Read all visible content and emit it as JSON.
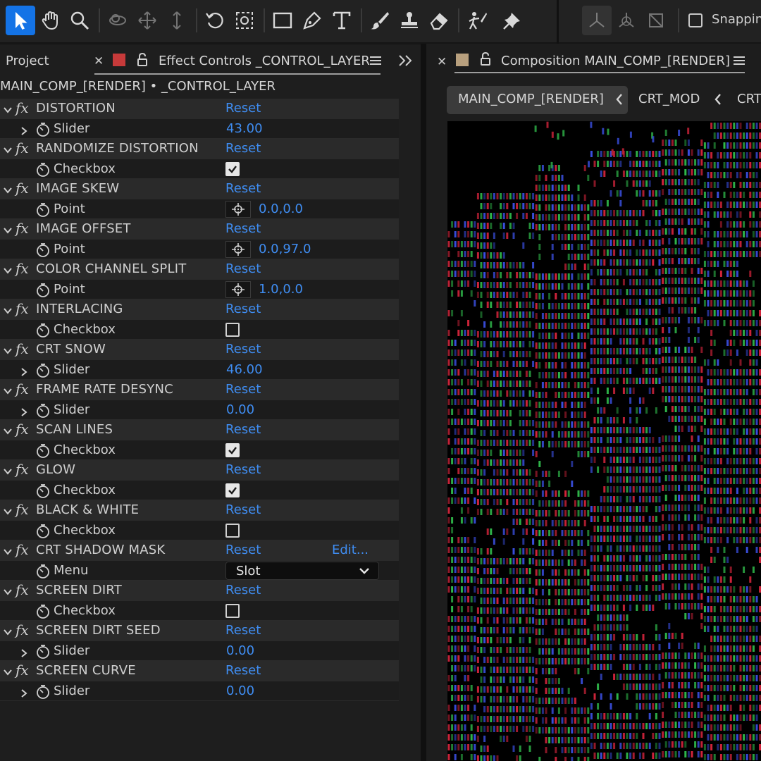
{
  "toolbar": {
    "tools": [
      "selection-tool",
      "hand-tool",
      "zoom-tool",
      "orbit-camera-tool",
      "pan-camera-tool",
      "dolly-camera-tool",
      "rotation-tool",
      "pan-behind-tool",
      "rectangle-tool",
      "pen-tool",
      "type-tool",
      "brush-tool",
      "clone-stamp-tool",
      "eraser-tool",
      "roto-brush-tool",
      "puppet-pin-tool",
      "local-axis-mode",
      "world-axis-mode",
      "view-axis-mode"
    ],
    "active_tool": "selection-tool",
    "snapping_label": "Snapping",
    "accent": "#1473e6"
  },
  "left_panel": {
    "project_tab": "Project",
    "effect_controls_tab": "Effect Controls _CONTROL_LAYER",
    "label_color": "#c73a3a",
    "breadcrumb": "MAIN_COMP_[RENDER] • _CONTROL_LAYER",
    "reset_label": "Reset",
    "effects": [
      {
        "name": "DISTORTION",
        "prop": "Slider",
        "kind": "slider",
        "value": "43.00"
      },
      {
        "name": "RANDOMIZE DISTORTION",
        "prop": "Checkbox",
        "kind": "checkbox",
        "checked": true
      },
      {
        "name": "IMAGE SKEW",
        "prop": "Point",
        "kind": "point",
        "value": "0.0,0.0"
      },
      {
        "name": "IMAGE OFFSET",
        "prop": "Point",
        "kind": "point",
        "value": "0.0,97.0"
      },
      {
        "name": "COLOR CHANNEL SPLIT",
        "prop": "Point",
        "kind": "point",
        "value": "1.0,0.0"
      },
      {
        "name": "INTERLACING",
        "prop": "Checkbox",
        "kind": "checkbox",
        "checked": false
      },
      {
        "name": "CRT SNOW",
        "prop": "Slider",
        "kind": "slider",
        "value": "46.00"
      },
      {
        "name": "FRAME RATE DESYNC",
        "prop": "Slider",
        "kind": "slider",
        "value": "0.00"
      },
      {
        "name": "SCAN LINES",
        "prop": "Checkbox",
        "kind": "checkbox",
        "checked": true
      },
      {
        "name": "GLOW",
        "prop": "Checkbox",
        "kind": "checkbox",
        "checked": true
      },
      {
        "name": "BLACK & WHITE",
        "prop": "Checkbox",
        "kind": "checkbox",
        "checked": false
      },
      {
        "name": "CRT SHADOW MASK",
        "prop": "Menu",
        "kind": "menu",
        "value": "Slot",
        "edit": "Edit..."
      },
      {
        "name": "SCREEN DIRT",
        "prop": "Checkbox",
        "kind": "checkbox",
        "checked": false
      },
      {
        "name": "SCREEN DIRT SEED",
        "prop": "Slider",
        "kind": "slider",
        "value": "0.00"
      },
      {
        "name": "SCREEN CURVE",
        "prop": "Slider",
        "kind": "slider",
        "value": "0.00"
      }
    ]
  },
  "right_panel": {
    "composition_tab": "Composition MAIN_COMP_[RENDER]",
    "label_color": "#b8a07e",
    "flowchart": [
      "MAIN_COMP_[RENDER]",
      "CRT_MOD",
      "CRT"
    ]
  }
}
